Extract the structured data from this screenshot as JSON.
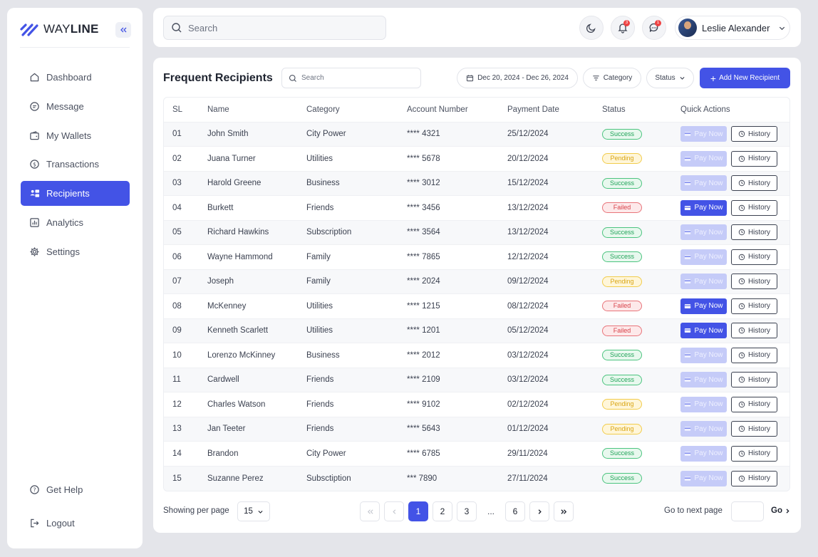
{
  "brand": {
    "name_light": "WAY",
    "name_bold": "LINE"
  },
  "sidebar": {
    "items": [
      {
        "label": "Dashboard",
        "icon": "home-icon"
      },
      {
        "label": "Message",
        "icon": "message-icon"
      },
      {
        "label": "My Wallets",
        "icon": "wallet-icon"
      },
      {
        "label": "Transactions",
        "icon": "transactions-icon"
      },
      {
        "label": "Recipients",
        "icon": "recipients-icon",
        "active": true
      },
      {
        "label": "Analytics",
        "icon": "analytics-icon"
      },
      {
        "label": "Settings",
        "icon": "gear-icon"
      }
    ],
    "help_label": "Get Help",
    "logout_label": "Logout"
  },
  "topbar": {
    "search_placeholder": "Search",
    "notifications_count": "3",
    "messages_count": "1",
    "user_name": "Leslie Alexander"
  },
  "main": {
    "title": "Frequent Recipients",
    "search_placeholder": "Search",
    "date_range": "Dec 20, 2024 - Dec 26, 2024",
    "category_filter": "Category",
    "status_filter": "Status",
    "add_button": "Add New Recipient",
    "columns": [
      "SL",
      "Name",
      "Category",
      "Account Number",
      "Payment Date",
      "Status",
      "Quick Actions"
    ],
    "pay_label": "Pay Now",
    "history_label": "History",
    "rows": [
      {
        "sl": "01",
        "name": "John Smith",
        "category": "City Power",
        "account": "**** 4321",
        "date": "25/12/2024",
        "status": "Success"
      },
      {
        "sl": "02",
        "name": "Juana Turner",
        "category": "Utilities",
        "account": "**** 5678",
        "date": "20/12/2024",
        "status": "Pending"
      },
      {
        "sl": "03",
        "name": "Harold Greene",
        "category": "Business",
        "account": "**** 3012",
        "date": "15/12/2024",
        "status": "Success"
      },
      {
        "sl": "04",
        "name": "Burkett",
        "category": "Friends",
        "account": "**** 3456",
        "date": "13/12/2024",
        "status": "Failed"
      },
      {
        "sl": "05",
        "name": "Richard Hawkins",
        "category": "Subscription",
        "account": "**** 3564",
        "date": "13/12/2024",
        "status": "Success"
      },
      {
        "sl": "06",
        "name": "Wayne Hammond",
        "category": "Family",
        "account": "**** 7865",
        "date": "12/12/2024",
        "status": "Success"
      },
      {
        "sl": "07",
        "name": "Joseph",
        "category": "Family",
        "account": "**** 2024",
        "date": "09/12/2024",
        "status": "Pending"
      },
      {
        "sl": "08",
        "name": "McKenney",
        "category": "Utilities",
        "account": "**** 1215",
        "date": "08/12/2024",
        "status": "Failed"
      },
      {
        "sl": "09",
        "name": "Kenneth Scarlett",
        "category": "Utilities",
        "account": "**** 1201",
        "date": "05/12/2024",
        "status": "Failed"
      },
      {
        "sl": "10",
        "name": "Lorenzo McKinney",
        "category": "Business",
        "account": "**** 2012",
        "date": "03/12/2024",
        "status": "Success"
      },
      {
        "sl": "11",
        "name": "Cardwell",
        "category": "Friends",
        "account": "**** 2109",
        "date": "03/12/2024",
        "status": "Success"
      },
      {
        "sl": "12",
        "name": "Charles Watson",
        "category": "Friends",
        "account": "**** 9102",
        "date": "02/12/2024",
        "status": "Pending"
      },
      {
        "sl": "13",
        "name": "Jan Teeter",
        "category": "Friends",
        "account": "**** 5643",
        "date": "01/12/2024",
        "status": "Pending"
      },
      {
        "sl": "14",
        "name": "Brandon",
        "category": "City Power",
        "account": "**** 6785",
        "date": "29/11/2024",
        "status": "Success"
      },
      {
        "sl": "15",
        "name": "Suzanne Perez",
        "category": "Subsctiption",
        "account": "*** 7890",
        "date": "27/11/2024",
        "status": "Success"
      }
    ]
  },
  "pagination": {
    "per_page_label": "Showing per page",
    "per_page_value": "15",
    "pages": [
      "1",
      "2",
      "3",
      "...",
      "6"
    ],
    "current_page": "1",
    "go_label": "Go to next page",
    "go_button": "Go"
  },
  "colors": {
    "accent": "#4353e6",
    "success": "#22a45a",
    "pending": "#d9a514",
    "failed": "#d8424a"
  }
}
